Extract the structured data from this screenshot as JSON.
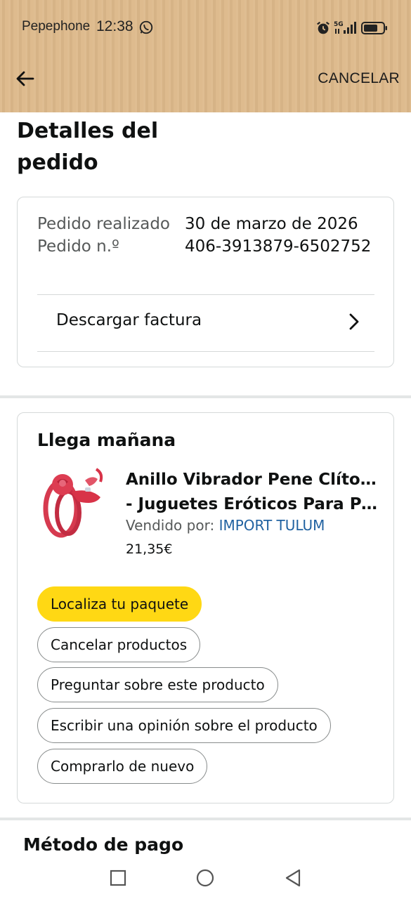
{
  "status_bar": {
    "carrier": "Pepephone",
    "time": "12:38",
    "network": "5G"
  },
  "app_bar": {
    "cancel_label": "CANCELAR",
    "back_icon": "arrow-left-icon"
  },
  "page": {
    "title": "Detalles del pedido"
  },
  "order_info": {
    "placed_label": "Pedido realizado",
    "number_label": "Pedido n.º",
    "placed_date": "30 de marzo de 2026",
    "order_number": "406-3913879-6502752",
    "invoice_label": "Descargar factura"
  },
  "delivery": {
    "status": "Llega mañana",
    "product": {
      "title_line1": "Anillo Vibrador Pene Clítoris",
      "title_line2": "- Juguetes Eróticos Para Pa...",
      "seller_prefix": "Vendido por: ",
      "seller": "IMPORT TULUM",
      "price": "21,35€",
      "image_icon": "product-image"
    },
    "actions": [
      {
        "label": "Localiza tu paquete",
        "primary": true
      },
      {
        "label": "Cancelar productos",
        "primary": false
      },
      {
        "label": "Preguntar sobre este producto",
        "primary": false
      },
      {
        "label": "Escribir una opinión sobre el producto",
        "primary": false
      },
      {
        "label": "Comprarlo de nuevo",
        "primary": false
      }
    ]
  },
  "payment": {
    "title": "Método de pago"
  },
  "colors": {
    "header_bg": "#ddb98a",
    "primary_button": "#ffd814",
    "link": "#2162a1",
    "border": "#d5d9d9",
    "text_secondary": "#565959"
  }
}
